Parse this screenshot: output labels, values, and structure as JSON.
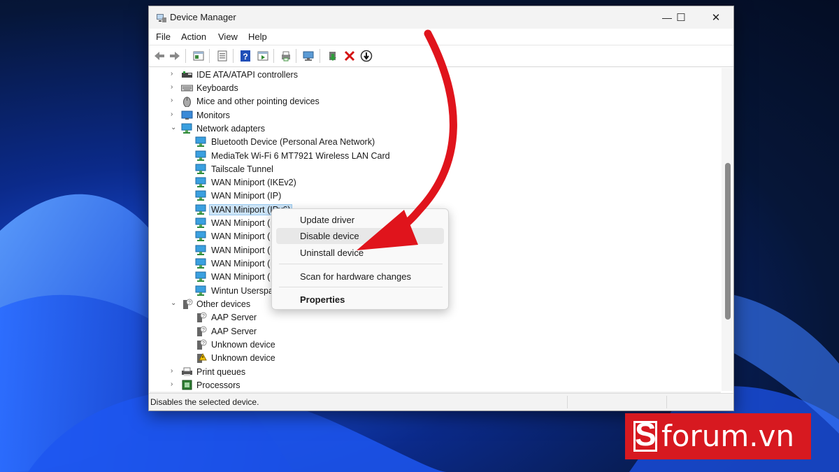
{
  "window": {
    "title": "Device Manager",
    "min": "—",
    "max": "☐",
    "close": "✕"
  },
  "menu": [
    "File",
    "Action",
    "View",
    "Help"
  ],
  "tree": [
    {
      "label": "IDE ATA/ATAPI controllers",
      "exp": "›",
      "icon": "ide-controller-icon"
    },
    {
      "label": "Keyboards",
      "exp": "›",
      "icon": "keyboard-icon"
    },
    {
      "label": "Mice and other pointing devices",
      "exp": "›",
      "icon": "mouse-icon"
    },
    {
      "label": "Monitors",
      "exp": "›",
      "icon": "monitor-icon"
    },
    {
      "label": "Network adapters",
      "exp": "⌄",
      "icon": "network-adapter-icon"
    },
    {
      "label": "Bluetooth Device (Personal Area Network)",
      "icon": "network-adapter-icon"
    },
    {
      "label": "MediaTek Wi-Fi 6 MT7921 Wireless LAN Card",
      "icon": "network-adapter-icon"
    },
    {
      "label": "Tailscale Tunnel",
      "icon": "network-adapter-icon"
    },
    {
      "label": "WAN Miniport (IKEv2)",
      "icon": "network-adapter-icon"
    },
    {
      "label": "WAN Miniport (IP)",
      "icon": "network-adapter-icon"
    },
    {
      "label": "WAN Miniport (IPv6)",
      "icon": "network-adapter-icon",
      "selected": true
    },
    {
      "label": "WAN Miniport (",
      "icon": "network-adapter-icon"
    },
    {
      "label": "WAN Miniport (",
      "icon": "network-adapter-icon"
    },
    {
      "label": "WAN Miniport (",
      "icon": "network-adapter-icon"
    },
    {
      "label": "WAN Miniport (",
      "icon": "network-adapter-icon"
    },
    {
      "label": "WAN Miniport (",
      "icon": "network-adapter-icon"
    },
    {
      "label": "Wintun Userspa",
      "icon": "network-adapter-icon"
    },
    {
      "label": "Other devices",
      "exp": "⌄",
      "icon": "unknown-device-icon"
    },
    {
      "label": "AAP Server",
      "icon": "unknown-device-icon"
    },
    {
      "label": "AAP Server",
      "icon": "unknown-device-icon"
    },
    {
      "label": "Unknown device",
      "icon": "unknown-device-icon"
    },
    {
      "label": "Unknown device",
      "icon": "warning-device-icon"
    },
    {
      "label": "Print queues",
      "exp": "›",
      "icon": "printer-icon"
    },
    {
      "label": "Processors",
      "exp": "›",
      "icon": "processor-icon"
    }
  ],
  "context_menu": {
    "update": "Update driver",
    "disable": "Disable device",
    "uninstall": "Uninstall device",
    "scan": "Scan for hardware changes",
    "properties": "Properties"
  },
  "status": "Disables the selected device.",
  "brand": {
    "mark": "S",
    "name": "forum.vn",
    "color": "#d71920"
  },
  "colors": {
    "arrow": "#e0141c",
    "selection": "#cce4f7"
  }
}
